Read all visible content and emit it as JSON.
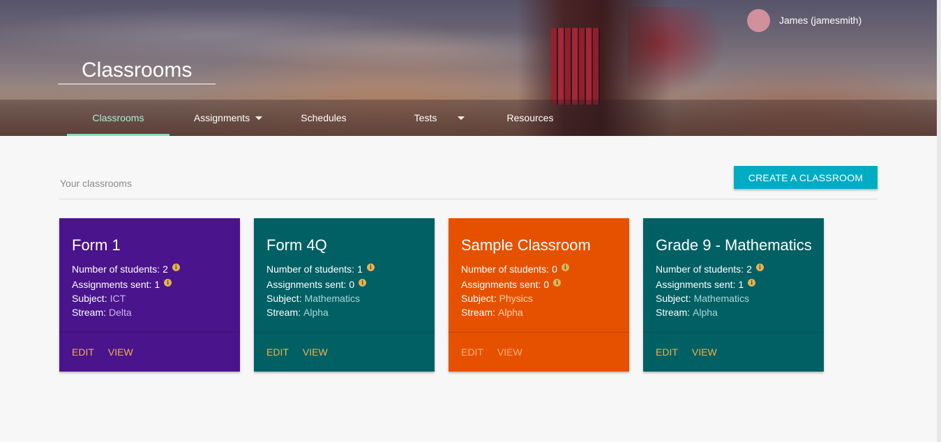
{
  "header": {
    "user_name": "James (jamesmith)",
    "page_title": "Classrooms"
  },
  "nav": {
    "items": [
      {
        "label": "Classrooms",
        "active": true,
        "has_caret": false
      },
      {
        "label": "Assignments",
        "active": false,
        "has_caret": true
      },
      {
        "label": "Schedules",
        "active": false,
        "has_caret": false
      },
      {
        "label": "Tests",
        "active": false,
        "has_caret": true
      },
      {
        "label": "Resources",
        "active": false,
        "has_caret": false
      }
    ]
  },
  "main": {
    "section_label": "Your classrooms",
    "create_button": "CREATE A CLASSROOM",
    "labels": {
      "students": "Number of students:",
      "assignments": "Assignments sent:",
      "subject": "Subject:",
      "stream": "Stream:",
      "info_glyph": "i",
      "edit": "EDIT",
      "view": "VIEW"
    },
    "cards": [
      {
        "title": "Form 1",
        "students": "2",
        "assignments": "1",
        "subject": "ICT",
        "stream": "Delta",
        "color": "#4a148c"
      },
      {
        "title": "Form 4Q",
        "students": "1",
        "assignments": "0",
        "subject": "Mathematics",
        "stream": "Alpha",
        "color": "#006064"
      },
      {
        "title": "Sample Classroom",
        "students": "0",
        "assignments": "0",
        "subject": "Physics",
        "stream": "Alpha",
        "color": "#e65100"
      },
      {
        "title": "Grade 9 - Mathematics",
        "students": "2",
        "assignments": "1",
        "subject": "Mathematics",
        "stream": "Alpha",
        "color": "#006064"
      }
    ]
  },
  "colors": {
    "accent": "#00acc1",
    "nav_active": "#84e0c2",
    "action_link": "#f4b04a"
  }
}
